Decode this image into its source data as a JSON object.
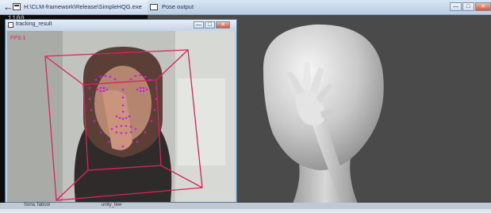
{
  "console": {
    "title": "H:\\CLM-framework\\Release\\SimpleHQG.exe",
    "output_line": "1100",
    "back_icon": "back-arrow-icon"
  },
  "pose_window": {
    "title": "Pose output",
    "controls": {
      "minimize": "minimize-icon",
      "maximize": "maximize-icon",
      "close": "close-icon"
    },
    "background": "#474747"
  },
  "tracking_window": {
    "title": "tracking_result",
    "fps_label": "FPS:1",
    "box_color": "#d8245e",
    "landmark_color": "#c81ee0"
  },
  "taskbar": {
    "item_1": "Sona Taboo!",
    "item_2": "unity_few"
  }
}
